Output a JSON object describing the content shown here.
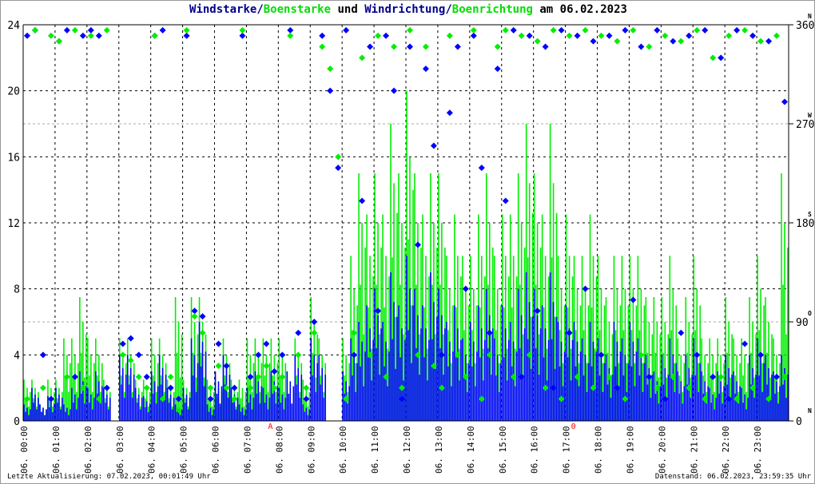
{
  "chart_data": {
    "type": "line",
    "title": {
      "part1": "Windstarke",
      "sep1": "/",
      "part2": "Boenstarke",
      "mid": " und ",
      "part3": "Windrichtung",
      "sep2": "/",
      "part4": "Boenrichtung",
      "tail": " am 06.02.2023"
    },
    "colors": {
      "wind": "#0000ff",
      "gust": "#00ee00",
      "grid": "#000000",
      "grid2": "#aaaaaa",
      "marker": "#ff0000"
    },
    "left_axis": {
      "ylim": [
        0,
        24
      ],
      "ticks": [
        "0",
        "4",
        "8",
        "12",
        "16",
        "20",
        "24"
      ]
    },
    "right_axis": {
      "ylim": [
        0,
        360
      ],
      "ticks": [
        "0",
        "90",
        "180",
        "270",
        "360"
      ],
      "compass": [
        "N",
        "O",
        "S",
        "W",
        "N"
      ]
    },
    "x_ticks": [
      "06. 00:00",
      "06. 01:00",
      "06. 02:00",
      "06. 03:00",
      "06. 04:00",
      "06. 05:00",
      "06. 06:00",
      "06. 07:00",
      "06. 08:00",
      "06. 09:00",
      "06. 10:00",
      "06. 11:00",
      "06. 12:00",
      "06. 13:00",
      "06. 14:00",
      "06. 15:00",
      "06. 16:00",
      "06. 17:00",
      "06. 18:00",
      "06. 19:00",
      "06. 20:00",
      "06. 21:00",
      "06. 22:00",
      "06. 23:00"
    ],
    "x_unit": "hours, 15-minute samples",
    "series": [
      {
        "name": "Windstarke",
        "values": [
          1,
          2,
          1,
          1.5,
          2,
          1,
          2,
          3,
          2,
          3,
          2,
          0,
          4,
          4,
          2,
          1.5,
          3,
          4,
          2,
          1,
          2,
          5,
          6,
          1,
          3,
          4,
          2,
          1,
          2,
          3,
          2,
          3,
          2,
          3,
          4,
          1,
          5,
          4,
          0,
          0,
          3,
          5,
          6,
          7,
          8,
          6,
          9,
          7,
          10,
          8,
          7,
          9,
          8,
          6,
          7,
          5,
          6,
          7,
          8,
          5,
          7,
          6,
          8,
          9,
          8,
          7,
          9,
          6,
          7,
          6,
          5,
          6,
          5,
          4,
          6,
          5,
          6,
          5,
          4,
          3,
          4,
          5,
          3,
          4,
          5,
          3,
          2,
          3,
          4,
          3,
          2,
          4,
          5,
          4,
          3,
          4
        ]
      },
      {
        "name": "Boenstarke",
        "values": [
          2.5,
          2.5,
          1,
          2.5,
          2.5,
          5,
          5,
          7.5,
          5,
          5,
          2.5,
          0,
          5,
          5,
          2.5,
          2.5,
          5,
          5,
          2.5,
          7.5,
          2.5,
          7.5,
          7.5,
          2.5,
          2.5,
          5,
          2.5,
          2.5,
          5,
          5,
          5,
          5,
          5,
          2.5,
          5,
          2.5,
          7.5,
          5,
          0,
          0,
          5,
          10,
          15,
          12.5,
          15,
          12.5,
          18,
          15,
          20,
          15,
          12.5,
          15,
          15,
          10,
          12.5,
          10,
          10,
          12.5,
          15,
          10,
          12.5,
          12.5,
          15,
          18,
          15,
          12.5,
          18,
          10,
          12.5,
          10,
          10,
          12.5,
          10,
          7.5,
          10,
          10,
          10,
          10,
          7.5,
          7.5,
          7.5,
          10,
          5,
          7.5,
          10,
          5,
          5,
          5,
          7.5,
          5,
          5,
          7.5,
          10,
          7.5,
          5,
          15
        ]
      }
    ],
    "directions": [
      {
        "name": "Windrichtung",
        "values": [
          350,
          355,
          60,
          20,
          345,
          355,
          40,
          350,
          355,
          350,
          30,
          0,
          70,
          75,
          60,
          40,
          350,
          355,
          30,
          20,
          350,
          100,
          95,
          20,
          70,
          50,
          30,
          350,
          40,
          60,
          70,
          45,
          60,
          355,
          80,
          20,
          90,
          350,
          300,
          230,
          355,
          60,
          200,
          340,
          100,
          350,
          300,
          20,
          340,
          160,
          320,
          250,
          60,
          280,
          340,
          120,
          350,
          230,
          80,
          320,
          200,
          355,
          40,
          350,
          100,
          340,
          30,
          355,
          80,
          350,
          120,
          345,
          60,
          350,
          30,
          355,
          110,
          340,
          40,
          355,
          20,
          345,
          80,
          350,
          60,
          355,
          40,
          330,
          20,
          355,
          70,
          350,
          60,
          345,
          40,
          290
        ]
      },
      {
        "name": "Boenrichtung",
        "values": [
          20,
          355,
          30,
          350,
          345,
          40,
          355,
          30,
          350,
          20,
          355,
          0,
          60,
          55,
          40,
          30,
          350,
          20,
          40,
          10,
          355,
          95,
          80,
          30,
          50,
          30,
          20,
          355,
          30,
          40,
          50,
          30,
          40,
          350,
          60,
          30,
          80,
          340,
          320,
          240,
          20,
          80,
          330,
          60,
          350,
          40,
          340,
          30,
          355,
          60,
          340,
          50,
          30,
          350,
          60,
          40,
          355,
          20,
          60,
          340,
          355,
          40,
          350,
          60,
          345,
          30,
          355,
          20,
          350,
          40,
          355,
          30,
          350,
          40,
          345,
          20,
          355,
          60,
          340,
          30,
          350,
          40,
          345,
          30,
          355,
          20,
          330,
          40,
          350,
          20,
          355,
          30,
          345,
          20,
          350,
          40
        ]
      }
    ],
    "markers": [
      {
        "hour": 7.75,
        "text": "A"
      },
      {
        "hour": 17.25,
        "text": "0"
      }
    ]
  },
  "footer": {
    "left": "Letzte Aktualisierung: 07.02.2023, 00:01:49 Uhr",
    "right": "Datenstand: 06.02.2023, 23:59:35 Uhr"
  }
}
